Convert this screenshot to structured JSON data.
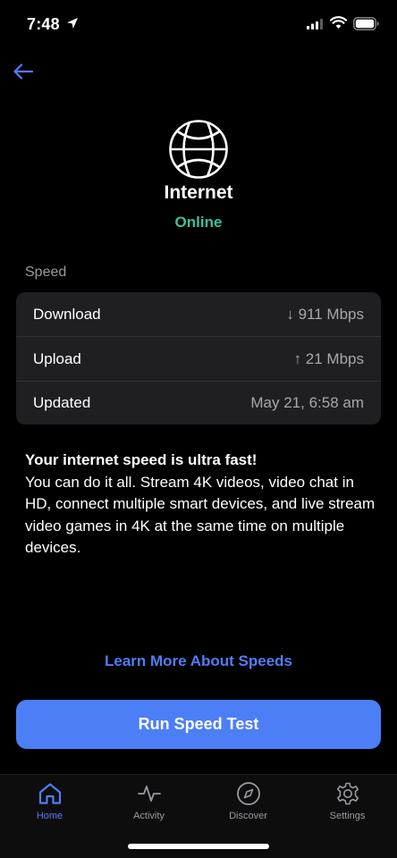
{
  "status_bar": {
    "time": "7:48"
  },
  "header": {
    "title": "Internet",
    "status": "Online",
    "status_color": "#3ebf9c"
  },
  "speed": {
    "section_label": "Speed",
    "rows": [
      {
        "label": "Download",
        "value": "↓ 911 Mbps"
      },
      {
        "label": "Upload",
        "value": "↑ 21 Mbps"
      },
      {
        "label": "Updated",
        "value": "May 21, 6:58 am"
      }
    ]
  },
  "message": {
    "heading": "Your internet speed is ultra fast!",
    "body": "You can do it all. Stream 4K videos, video chat in HD, connect multiple smart devices, and live stream video games in 4K at the same time on multiple devices."
  },
  "learn_more_link": "Learn More About Speeds",
  "run_button": "Run Speed Test",
  "tabs": [
    {
      "label": "Home",
      "icon": "home-icon",
      "active": true
    },
    {
      "label": "Activity",
      "icon": "activity-icon",
      "active": false
    },
    {
      "label": "Discover",
      "icon": "compass-icon",
      "active": false
    },
    {
      "label": "Settings",
      "icon": "gear-icon",
      "active": false
    }
  ],
  "colors": {
    "accent": "#4c7ef6",
    "background": "#000000",
    "card": "#1f1f21"
  }
}
